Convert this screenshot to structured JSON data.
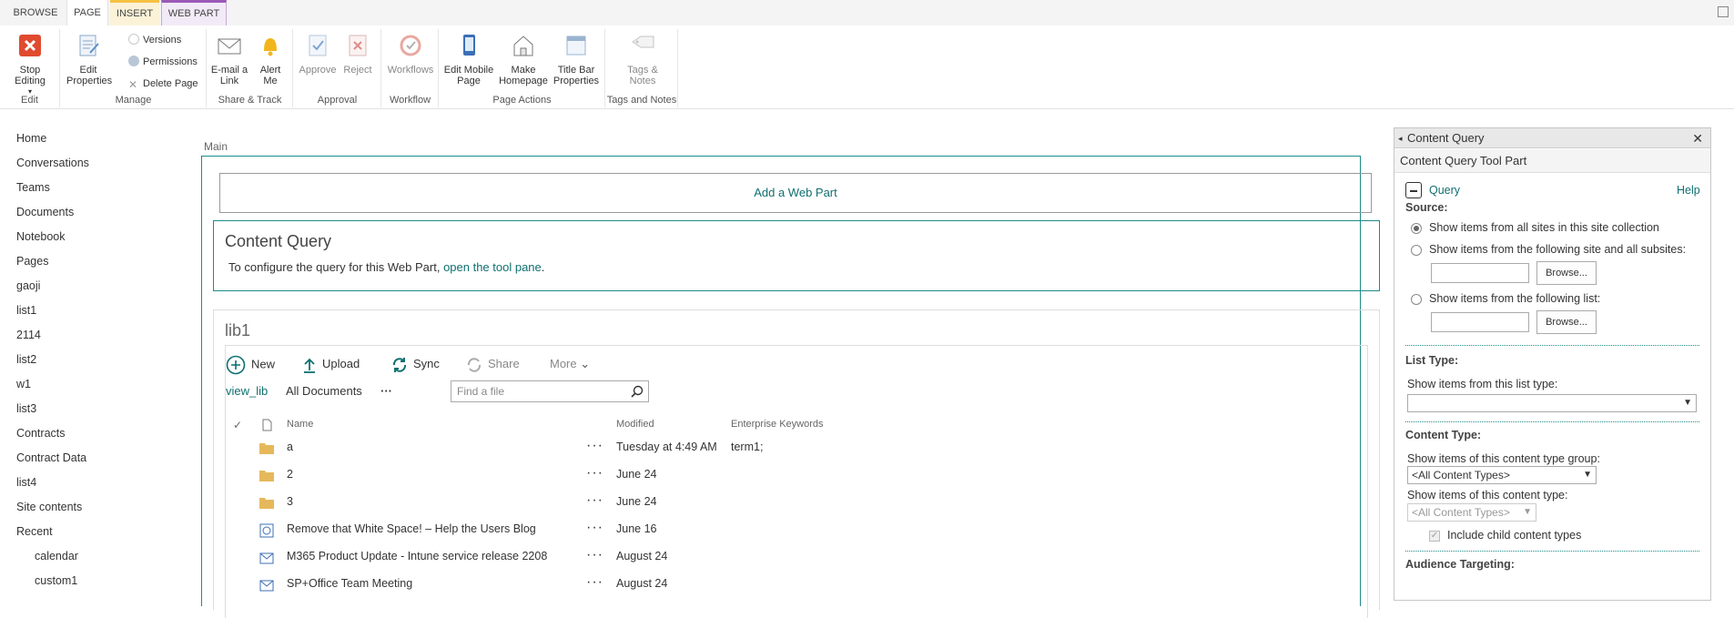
{
  "tabs": [
    "BROWSE",
    "PAGE",
    "INSERT",
    "WEB PART"
  ],
  "ribbon": {
    "edit": {
      "stop_editing": "Stop Editing",
      "group": "Edit"
    },
    "manage": {
      "edit_properties": "Edit Properties",
      "versions": "Versions",
      "permissions": "Permissions",
      "delete_page": "Delete Page",
      "group": "Manage"
    },
    "share": {
      "email_link": "E-mail a Link",
      "alert_me": "Alert Me",
      "group": "Share & Track"
    },
    "approval": {
      "approve": "Approve",
      "reject": "Reject",
      "group": "Approval"
    },
    "workflow": {
      "workflows": "Workflows",
      "group": "Workflow"
    },
    "page_actions": {
      "edit_mobile": "Edit Mobile Page",
      "make_homepage": "Make Homepage",
      "title_bar": "Title Bar Properties",
      "group": "Page Actions"
    },
    "tags": {
      "tags_notes": "Tags & Notes",
      "group": "Tags and Notes"
    }
  },
  "leftnav": [
    "Home",
    "Conversations",
    "Teams",
    "Documents",
    "Notebook",
    "Pages",
    "gaoji",
    "list1",
    "2114",
    "list2",
    "w1",
    "list3",
    "Contracts",
    "Contract Data",
    "list4",
    "Site contents",
    "Recent"
  ],
  "leftnav_recent": [
    "calendar",
    "custom1"
  ],
  "main": {
    "zone_label": "Main",
    "add_web_part": "Add a Web Part",
    "cq_title": "Content Query",
    "cq_text": "To configure the query for this Web Part,",
    "cq_link": "open the tool pane",
    "cq_period": "."
  },
  "library": {
    "title": "lib1",
    "commands": {
      "new": "New",
      "upload": "Upload",
      "sync": "Sync",
      "share": "Share",
      "more": "More"
    },
    "views": {
      "current": "view_lib",
      "all": "All Documents",
      "ellipsis": "···"
    },
    "search_placeholder": "Find a file",
    "columns": {
      "name": "Name",
      "modified": "Modified",
      "keywords": "Enterprise Keywords"
    },
    "rows": [
      {
        "type": "folder",
        "name": "a",
        "modified": "Tuesday at 4:49 AM",
        "keywords": "term1;"
      },
      {
        "type": "folder",
        "name": "2",
        "modified": "June 24",
        "keywords": ""
      },
      {
        "type": "folder",
        "name": "3",
        "modified": "June 24",
        "keywords": ""
      },
      {
        "type": "page",
        "name": "Remove that White Space! – Help the Users Blog",
        "modified": "June 16",
        "keywords": ""
      },
      {
        "type": "mail",
        "name": "M365 Product Update - Intune service release 2208",
        "modified": "August 24",
        "keywords": ""
      },
      {
        "type": "mail",
        "name": "SP+Office Team Meeting",
        "modified": "August 24",
        "keywords": ""
      }
    ]
  },
  "toolpane": {
    "title": "Content Query",
    "subtitle": "Content Query Tool Part",
    "query": "Query",
    "help": "Help",
    "source_label": "Source:",
    "opt_all_sites": "Show items from all sites in this site collection",
    "opt_site": "Show items from the following site and all subsites:",
    "opt_list": "Show items from the following list:",
    "browse": "Browse...",
    "list_type_label": "List Type:",
    "list_type_text": "Show items from this list type:",
    "content_type_label": "Content Type:",
    "ct_group_text": "Show items of this content type group:",
    "ct_group_value": "<All Content Types>",
    "ct_text": "Show items of this content type:",
    "ct_value": "<All Content Types>",
    "include_child": "Include child content types",
    "audience_label": "Audience Targeting:"
  },
  "colors": {
    "accent": "#0f6f6f",
    "stop_red": "#e04a2f",
    "bell": "#f2b51c",
    "folder": "#e6b85c"
  }
}
